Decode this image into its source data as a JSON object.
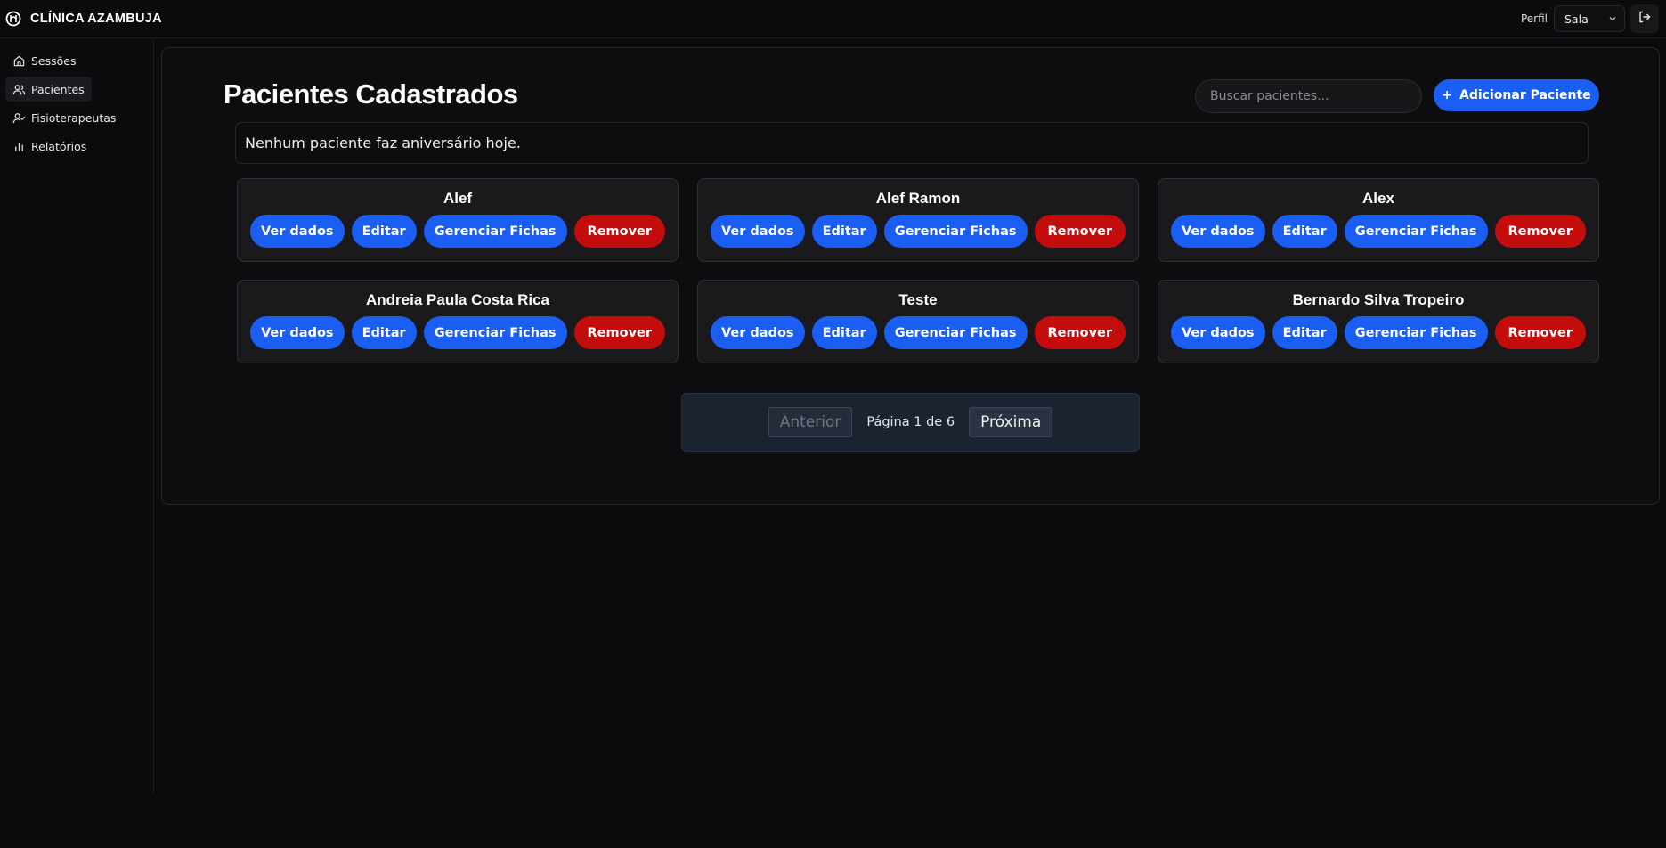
{
  "header": {
    "brand": "CLÍNICA AZAMBUJA",
    "profile_label": "Perfil",
    "profile_value": "Sala"
  },
  "sidebar": {
    "items": [
      {
        "label": "Sessões",
        "icon": "home-icon",
        "active": false
      },
      {
        "label": "Pacientes",
        "icon": "users-icon",
        "active": true
      },
      {
        "label": "Fisioterapeutas",
        "icon": "user-check-icon",
        "active": false
      },
      {
        "label": "Relatórios",
        "icon": "bar-chart-icon",
        "active": false
      }
    ]
  },
  "main": {
    "title": "Pacientes Cadastrados",
    "search_placeholder": "Buscar pacientes...",
    "add_label": "Adicionar Paciente",
    "add_icon": "+",
    "birthday_message": "Nenhum paciente faz aniversário hoje.",
    "actions": {
      "view": "Ver dados",
      "edit": "Editar",
      "manage": "Gerenciar Fichas",
      "remove": "Remover"
    },
    "patients": [
      {
        "name": "Alef"
      },
      {
        "name": "Alef Ramon"
      },
      {
        "name": "Alex"
      },
      {
        "name": "Andreia Paula Costa Rica"
      },
      {
        "name": "Teste"
      },
      {
        "name": "Bernardo Silva Tropeiro"
      }
    ],
    "pagination": {
      "prev": "Anterior",
      "info": "Página 1 de 6",
      "next": "Próxima"
    }
  },
  "colors": {
    "primary": "#1a5ef4",
    "danger": "#c30d0d",
    "background": "#0b0b0d"
  }
}
